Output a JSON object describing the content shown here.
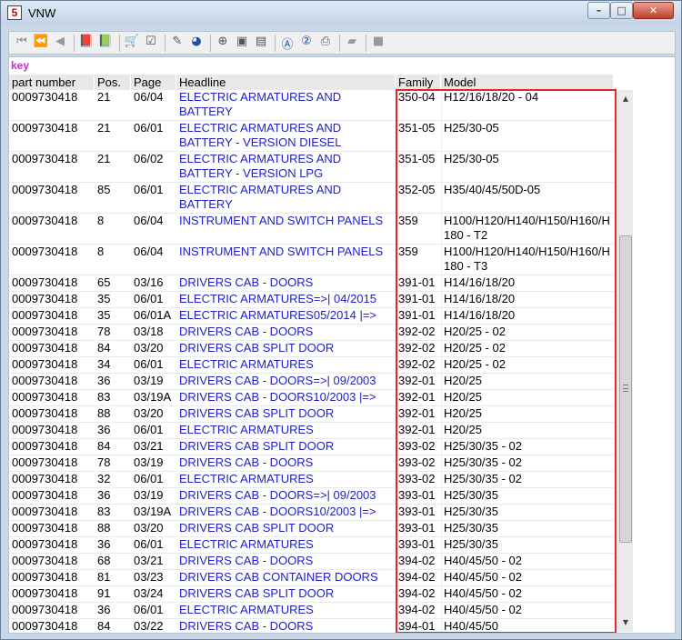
{
  "window": {
    "title": "VNW",
    "app_icon_glyph": "5"
  },
  "window_buttons": {
    "minimize": "–",
    "maximize": "□",
    "close": "✕"
  },
  "toolbar": [
    {
      "name": "first-icon",
      "glyph": "⏮",
      "style": "dis"
    },
    {
      "name": "rewind-icon",
      "glyph": "⏪",
      "style": "dis"
    },
    {
      "name": "prev-icon",
      "glyph": "◀",
      "style": "dis"
    },
    {
      "sep": true
    },
    {
      "name": "book-back-icon",
      "glyph": "📕",
      "style": "dis"
    },
    {
      "name": "book-forward-icon",
      "glyph": "📗",
      "style": "dis"
    },
    {
      "sep": true
    },
    {
      "name": "cart-icon",
      "glyph": "🛒",
      "style": ""
    },
    {
      "name": "checklist-icon",
      "glyph": "☑",
      "style": ""
    },
    {
      "sep": true
    },
    {
      "name": "marker-icon",
      "glyph": "✎",
      "style": ""
    },
    {
      "name": "globe-icon",
      "glyph": "◕",
      "style": "blue"
    },
    {
      "sep": true
    },
    {
      "name": "zoom-icon",
      "glyph": "⊕",
      "style": ""
    },
    {
      "name": "page-icon",
      "glyph": "▣",
      "style": ""
    },
    {
      "name": "page-copy-icon",
      "glyph": "▤",
      "style": ""
    },
    {
      "sep": true
    },
    {
      "name": "info-a-icon",
      "glyph": "Ⓐ",
      "style": "blue"
    },
    {
      "name": "info-2-icon",
      "glyph": "②",
      "style": "blue"
    },
    {
      "name": "print-icon",
      "glyph": "⎙",
      "style": ""
    },
    {
      "sep": true
    },
    {
      "name": "eraser-icon",
      "glyph": "▰",
      "style": "dis"
    },
    {
      "sep": true
    },
    {
      "name": "stop-icon",
      "glyph": "■",
      "style": "dis"
    }
  ],
  "key_label": "key",
  "columns": [
    "part number",
    "Pos.",
    "Page",
    "Headline",
    "Family",
    "Model"
  ],
  "rows": [
    {
      "part": "0009730418",
      "pos": "21",
      "page": "06/04",
      "headline": "ELECTRIC ARMATURES AND BATTERY",
      "family": "350-04",
      "model": "H12/16/18/20 - 04",
      "tall": true
    },
    {
      "part": "0009730418",
      "pos": "21",
      "page": "06/01",
      "headline": "ELECTRIC ARMATURES AND BATTERY - VERSION DIESEL",
      "family": "351-05",
      "model": "H25/30-05",
      "tall": true
    },
    {
      "part": "0009730418",
      "pos": "21",
      "page": "06/02",
      "headline": "ELECTRIC ARMATURES AND BATTERY - VERSION LPG",
      "family": "351-05",
      "model": "H25/30-05",
      "tall": true
    },
    {
      "part": "0009730418",
      "pos": "85",
      "page": "06/01",
      "headline": "ELECTRIC ARMATURES AND BATTERY",
      "family": "352-05",
      "model": "H35/40/45/50D-05",
      "tall": true
    },
    {
      "part": "0009730418",
      "pos": "8",
      "page": "06/04",
      "headline": "INSTRUMENT AND SWITCH PANELS",
      "family": "359",
      "model": "H100/H120/H140/H150/H160/H180 - T2",
      "tall": true
    },
    {
      "part": "0009730418",
      "pos": "8",
      "page": "06/04",
      "headline": "INSTRUMENT AND SWITCH PANELS",
      "family": "359",
      "model": "H100/H120/H140/H150/H160/H180 - T3",
      "tall": true
    },
    {
      "part": "0009730418",
      "pos": "65",
      "page": "03/16",
      "headline": "DRIVERS CAB - DOORS",
      "family": "391-01",
      "model": "H14/16/18/20",
      "tall": false
    },
    {
      "part": "0009730418",
      "pos": "35",
      "page": "06/01",
      "headline": "ELECTRIC ARMATURES=>| 04/2015",
      "family": "391-01",
      "model": "H14/16/18/20",
      "tall": false
    },
    {
      "part": "0009730418",
      "pos": "35",
      "page": "06/01A",
      "headline": "ELECTRIC ARMATURES05/2014 |=>",
      "family": "391-01",
      "model": "H14/16/18/20",
      "tall": false
    },
    {
      "part": "0009730418",
      "pos": "78",
      "page": "03/18",
      "headline": "DRIVERS CAB - DOORS",
      "family": "392-02",
      "model": "H20/25 - 02",
      "tall": false
    },
    {
      "part": "0009730418",
      "pos": "84",
      "page": "03/20",
      "headline": "DRIVERS CAB SPLIT DOOR",
      "family": "392-02",
      "model": "H20/25 - 02",
      "tall": false
    },
    {
      "part": "0009730418",
      "pos": "34",
      "page": "06/01",
      "headline": "ELECTRIC ARMATURES",
      "family": "392-02",
      "model": "H20/25 - 02",
      "tall": false
    },
    {
      "part": "0009730418",
      "pos": "36",
      "page": "03/19",
      "headline": "DRIVERS CAB - DOORS=>| 09/2003",
      "family": "392-01",
      "model": "H20/25",
      "tall": false
    },
    {
      "part": "0009730418",
      "pos": "83",
      "page": "03/19A",
      "headline": "DRIVERS CAB - DOORS10/2003 |=>",
      "family": "392-01",
      "model": "H20/25",
      "tall": false
    },
    {
      "part": "0009730418",
      "pos": "88",
      "page": "03/20",
      "headline": "DRIVERS CAB SPLIT DOOR",
      "family": "392-01",
      "model": "H20/25",
      "tall": false
    },
    {
      "part": "0009730418",
      "pos": "36",
      "page": "06/01",
      "headline": "ELECTRIC ARMATURES",
      "family": "392-01",
      "model": "H20/25",
      "tall": false
    },
    {
      "part": "0009730418",
      "pos": "84",
      "page": "03/21",
      "headline": "DRIVERS CAB SPLIT DOOR",
      "family": "393-02",
      "model": "H25/30/35 - 02",
      "tall": false
    },
    {
      "part": "0009730418",
      "pos": "78",
      "page": "03/19",
      "headline": "DRIVERS CAB - DOORS",
      "family": "393-02",
      "model": "H25/30/35 - 02",
      "tall": false
    },
    {
      "part": "0009730418",
      "pos": "32",
      "page": "06/01",
      "headline": "ELECTRIC ARMATURES",
      "family": "393-02",
      "model": "H25/30/35 - 02",
      "tall": false
    },
    {
      "part": "0009730418",
      "pos": "36",
      "page": "03/19",
      "headline": "DRIVERS CAB - DOORS=>| 09/2003",
      "family": "393-01",
      "model": "H25/30/35",
      "tall": false
    },
    {
      "part": "0009730418",
      "pos": "83",
      "page": "03/19A",
      "headline": "DRIVERS CAB - DOORS10/2003 |=>",
      "family": "393-01",
      "model": "H25/30/35",
      "tall": false
    },
    {
      "part": "0009730418",
      "pos": "88",
      "page": "03/20",
      "headline": "DRIVERS CAB SPLIT DOOR",
      "family": "393-01",
      "model": "H25/30/35",
      "tall": false
    },
    {
      "part": "0009730418",
      "pos": "36",
      "page": "06/01",
      "headline": "ELECTRIC ARMATURES",
      "family": "393-01",
      "model": "H25/30/35",
      "tall": false
    },
    {
      "part": "0009730418",
      "pos": "68",
      "page": "03/21",
      "headline": "DRIVERS CAB - DOORS",
      "family": "394-02",
      "model": "H40/45/50 - 02",
      "tall": false
    },
    {
      "part": "0009730418",
      "pos": "81",
      "page": "03/23",
      "headline": "DRIVERS CAB CONTAINER DOORS",
      "family": "394-02",
      "model": "H40/45/50 - 02",
      "tall": false
    },
    {
      "part": "0009730418",
      "pos": "91",
      "page": "03/24",
      "headline": "DRIVERS CAB SPLIT DOOR",
      "family": "394-02",
      "model": "H40/45/50 - 02",
      "tall": false
    },
    {
      "part": "0009730418",
      "pos": "36",
      "page": "06/01",
      "headline": "ELECTRIC ARMATURES",
      "family": "394-02",
      "model": "H40/45/50 - 02",
      "tall": false
    },
    {
      "part": "0009730418",
      "pos": "84",
      "page": "03/22",
      "headline": "DRIVERS CAB - DOORS",
      "family": "394-01",
      "model": "H40/45/50",
      "tall": false
    }
  ],
  "colors": {
    "headline_link": "#2121c4",
    "key_label": "#d02bd0",
    "highlight_box": "#e4262c"
  },
  "scrollbar": {
    "up_glyph": "▲",
    "down_glyph": "▼"
  }
}
